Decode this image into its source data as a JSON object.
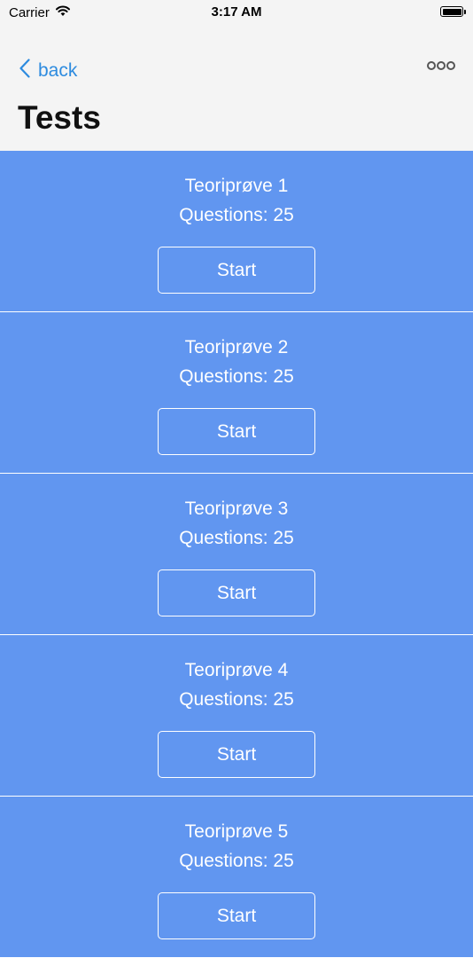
{
  "status_bar": {
    "carrier": "Carrier",
    "time": "3:17 AM"
  },
  "nav": {
    "back_label": "back",
    "more_icon": "ellipsis-icon",
    "title": "Tests"
  },
  "colors": {
    "accent": "#2d8bdf",
    "card_background": "#6196f0",
    "nav_background": "#f4f4f4"
  },
  "tests": [
    {
      "name": "Teoriprøve 1",
      "questions": "Questions: 25",
      "button": "Start"
    },
    {
      "name": "Teoriprøve 2",
      "questions": "Questions: 25",
      "button": "Start"
    },
    {
      "name": "Teoriprøve 3",
      "questions": "Questions: 25",
      "button": "Start"
    },
    {
      "name": "Teoriprøve 4",
      "questions": "Questions: 25",
      "button": "Start"
    },
    {
      "name": "Teoriprøve 5",
      "questions": "Questions: 25",
      "button": "Start"
    }
  ]
}
